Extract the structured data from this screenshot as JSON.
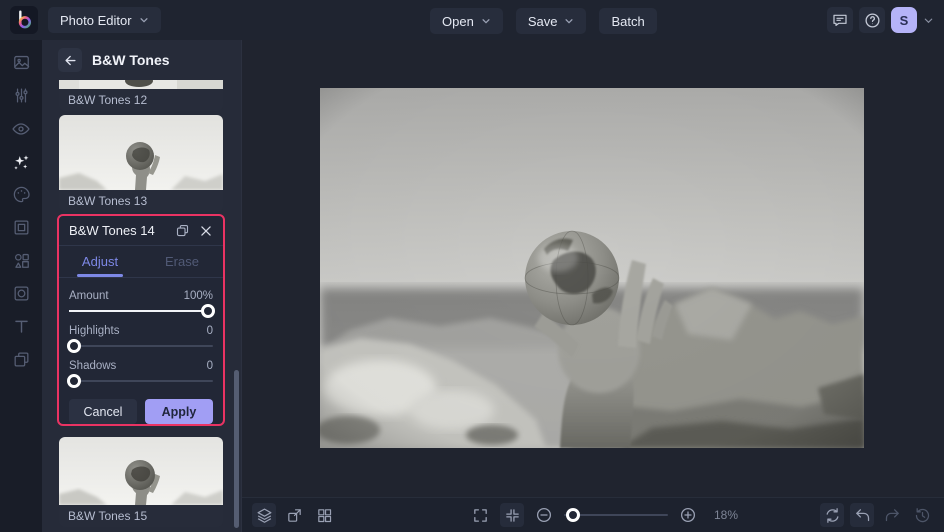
{
  "colors": {
    "accent_pink": "#ea3363",
    "tab_active": "#7d88e6",
    "apply_lavender": "#a19ef4",
    "avatar_lavender": "#b5b3f8",
    "topbar_bg": "#1f2430",
    "panel_bg": "#262b39",
    "canvas_bg": "#20242f"
  },
  "topbar": {
    "logo_icon": "befunky-logo",
    "app_title": "Photo Editor",
    "open_label": "Open",
    "save_label": "Save",
    "batch_label": "Batch",
    "right_icons": [
      "feedback-comment-icon",
      "help-icon"
    ],
    "avatar_initial": "S"
  },
  "sidebar": {
    "items": [
      {
        "name": "edit",
        "icon": "image-icon",
        "active": false
      },
      {
        "name": "adjust",
        "icon": "sliders-icon",
        "active": false
      },
      {
        "name": "touch-up",
        "icon": "eye-icon",
        "active": false
      },
      {
        "name": "effects",
        "icon": "sparkles-icon",
        "active": true
      },
      {
        "name": "artsy",
        "icon": "palette-icon",
        "active": false
      },
      {
        "name": "frames",
        "icon": "frame-icon",
        "active": false
      },
      {
        "name": "graphics",
        "icon": "shapes-icon",
        "active": false
      },
      {
        "name": "overlays",
        "icon": "overlay-icon",
        "active": false
      },
      {
        "name": "text",
        "icon": "text-icon",
        "active": false
      },
      {
        "name": "layers",
        "icon": "layers-icon",
        "active": false
      }
    ]
  },
  "panel": {
    "back_icon": "arrow-left-icon",
    "title": "B&W Tones",
    "items": [
      {
        "label": "B&W Tones 12"
      },
      {
        "label": "B&W Tones 13"
      },
      {
        "label": "B&W Tones 14",
        "expanded": true
      },
      {
        "label": "B&W Tones 15"
      }
    ],
    "card": {
      "title": "B&W Tones 14",
      "header_icons": [
        "duplicate-icon",
        "close-icon"
      ],
      "tabs": [
        {
          "label": "Adjust",
          "active": true
        },
        {
          "label": "Erase",
          "active": false
        }
      ],
      "sliders": [
        {
          "label": "Amount",
          "value": "100%",
          "position": 100
        },
        {
          "label": "Highlights",
          "value": "0",
          "position": 0
        },
        {
          "label": "Shadows",
          "value": "0",
          "position": 0
        }
      ],
      "cancel_label": "Cancel",
      "apply_label": "Apply"
    }
  },
  "canvas": {
    "image_description": "black and white photo of a hand holding a small world globe in front of blurred rocky mountains and a pale sky"
  },
  "bottombar": {
    "left_icons": [
      "layers-icon",
      "export-icon",
      "grid-icon"
    ],
    "center_icons": [
      "fullscreen-icon",
      "fit-screen-icon",
      "zoom-out-icon",
      "zoom-slider",
      "zoom-in-icon"
    ],
    "zoom_level": "18%",
    "right_icons": [
      "rotate-reset-icon",
      "undo-icon",
      "redo-icon",
      "history-icon"
    ]
  }
}
